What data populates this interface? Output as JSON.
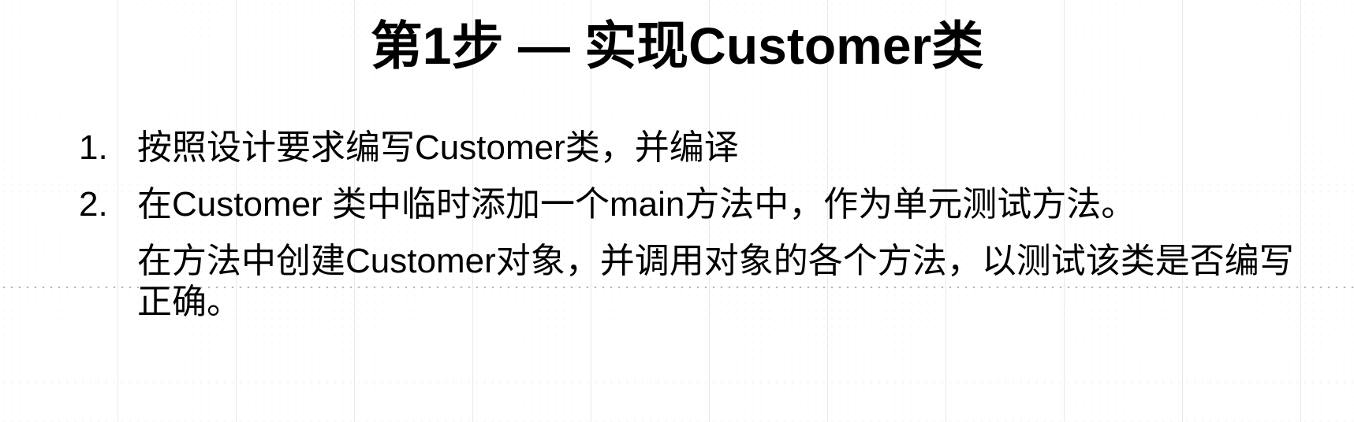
{
  "slide": {
    "title": "第1步 — 实现Customer类",
    "items": [
      {
        "number": "1.",
        "paragraphs": [
          "按照设计要求编写Customer类，并编译"
        ]
      },
      {
        "number": "2.",
        "paragraphs": [
          "在Customer 类中临时添加一个main方法中，作为单元测试方法。",
          "在方法中创建Customer对象，并调用对象的各个方法，以测试该类是否编写正确。"
        ]
      }
    ]
  }
}
